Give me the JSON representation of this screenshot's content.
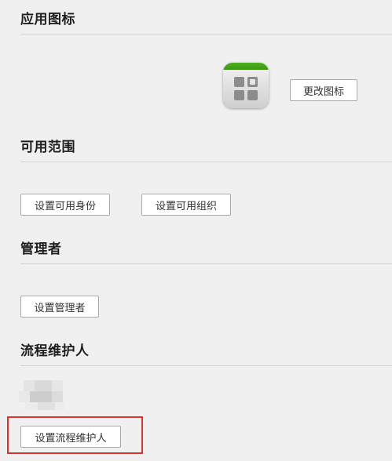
{
  "sections": {
    "app_icon": {
      "title": "应用图标",
      "change_icon_label": "更改图标"
    },
    "scope": {
      "title": "可用范围",
      "set_identity_label": "设置可用身份",
      "set_org_label": "设置可用组织"
    },
    "admin": {
      "title": "管理者",
      "set_admin_label": "设置管理者"
    },
    "maintainer": {
      "title": "流程维护人",
      "set_maintainer_label": "设置流程维护人"
    }
  },
  "colors": {
    "icon_green": "#3a9a12",
    "highlight_red": "#e03131"
  },
  "icons": {
    "app_icon": "app-grid-icon",
    "avatar": "blurred-avatar"
  }
}
